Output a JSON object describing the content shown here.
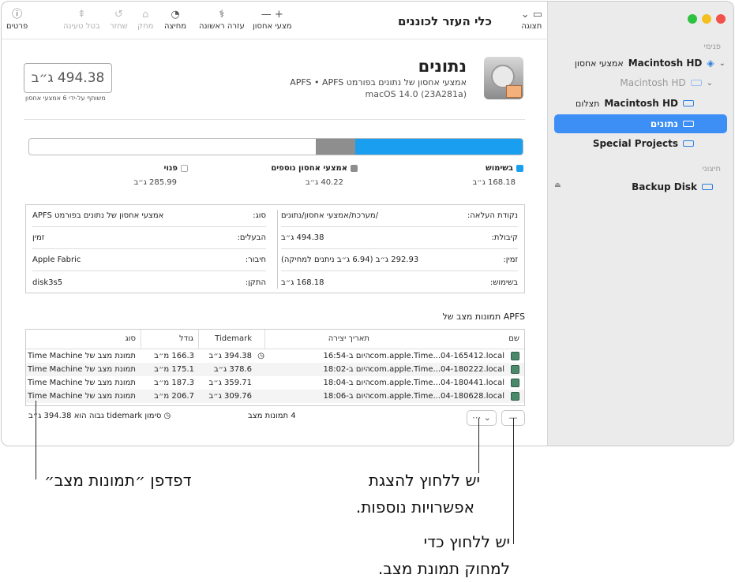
{
  "window": {
    "title": "כלי העזר לכוננים"
  },
  "toolbar": {
    "view": "תצוגה",
    "volume": "מצעי אחסון",
    "first_aid": "עזרה ראשונה",
    "partition": "מחיצה",
    "erase": "מחק",
    "restore": "שחזר",
    "unmount": "בטל טעינה",
    "info": "פרטים"
  },
  "sidebar": {
    "internal_label": "פנימי",
    "external_label": "חיצוני",
    "items": [
      {
        "name": "Macintosh HD",
        "sub": "אמצעי אחסון"
      },
      {
        "name": "Macintosh HD",
        "sub": ""
      },
      {
        "name": "Macintosh HD",
        "sub": "תצלום"
      },
      {
        "name": "נתונים",
        "sub": ""
      },
      {
        "name": "Special Projects",
        "sub": ""
      },
      {
        "name": "Backup Disk",
        "sub": ""
      }
    ]
  },
  "volume": {
    "name": "נתונים",
    "subtitle": "אמצעי אחסון של נתונים בפורמט APFS • APFS",
    "os": "macOS 14.0 (23A281a)",
    "capacity": "494.38 ג״ב",
    "capacity_note": "משותף על-ידי 6 אמצעי אחסון"
  },
  "usage": {
    "used": {
      "label": "בשימוש",
      "value": "168.18 ג״ב",
      "fraction": 0.34,
      "color": "#1a9ff0"
    },
    "other": {
      "label": "אמצעי אחסון נוספים",
      "value": "40.22 ג״ב",
      "fraction": 0.08,
      "color": "#8e8e8e"
    },
    "free": {
      "label": "פנוי",
      "value": "285.99 ג״ב",
      "fraction": 0.58,
      "color": "#ffffff"
    }
  },
  "info": {
    "right": [
      {
        "k": "נקודת העלאה:",
        "v": "/מערכת/אמצעי אחסון/נתונים"
      },
      {
        "k": "קיבולת:",
        "v": "494.38 ג״ב"
      },
      {
        "k": "זמין:",
        "v": "292.93 ג״ב (6.94 ג״ב ניתנים למחיקה)"
      },
      {
        "k": "בשימוש:",
        "v": "168.18 ג״ב"
      }
    ],
    "left": [
      {
        "k": "סוג:",
        "v": "אמצעי אחסון של נתונים בפורמט APFS"
      },
      {
        "k": "הבעלים:",
        "v": "זמין"
      },
      {
        "k": "חיבור:",
        "v": "Apple Fabric"
      },
      {
        "k": "התקן:",
        "v": "disk3s5"
      }
    ]
  },
  "snapshots": {
    "title": "תמונות מצב של APFS",
    "columns": {
      "name": "שם",
      "date": "תאריך יצירה",
      "tidemark": "Tidemark",
      "size": "גודל",
      "type": "סוג"
    },
    "rows": [
      {
        "name": "com.apple.Time...04-165412.local",
        "date": "היום ב-16:54",
        "tidemark": "394.38 ג״ב",
        "size": "166.3 מ״ב",
        "type": "תמונת מצב של Time Machine"
      },
      {
        "name": "com.apple.Time...04-180222.local",
        "date": "היום ב-18:02",
        "tidemark": "378.6 ג״ב",
        "size": "175.1 מ״ב",
        "type": "תמונת מצב של Time Machine"
      },
      {
        "name": "com.apple.Time...04-180441.local",
        "date": "היום ב-18:04",
        "tidemark": "359.71 ג״ב",
        "size": "187.3 מ״ב",
        "type": "תמונת מצב של Time Machine"
      },
      {
        "name": "com.apple.Time...04-180628.local",
        "date": "היום ב-18:06",
        "tidemark": "309.76 ג״ב",
        "size": "206.7 מ״ב",
        "type": "תמונת מצב של Time Machine"
      }
    ],
    "count": "4 תמונות מצב",
    "tidemark_note": "סימון tidemark גבוה הוא 394.38 ג״ב",
    "remove_btn": "—",
    "more_btn": "⋯ ⌄"
  },
  "callouts": {
    "browser": "דפדפן ״תמונות מצב״",
    "more_1": "יש ללחוץ להצגת",
    "more_2": "אפשרויות נוספות.",
    "delete_1": "יש ללחוץ כדי",
    "delete_2": "למחוק תמונת מצב."
  }
}
